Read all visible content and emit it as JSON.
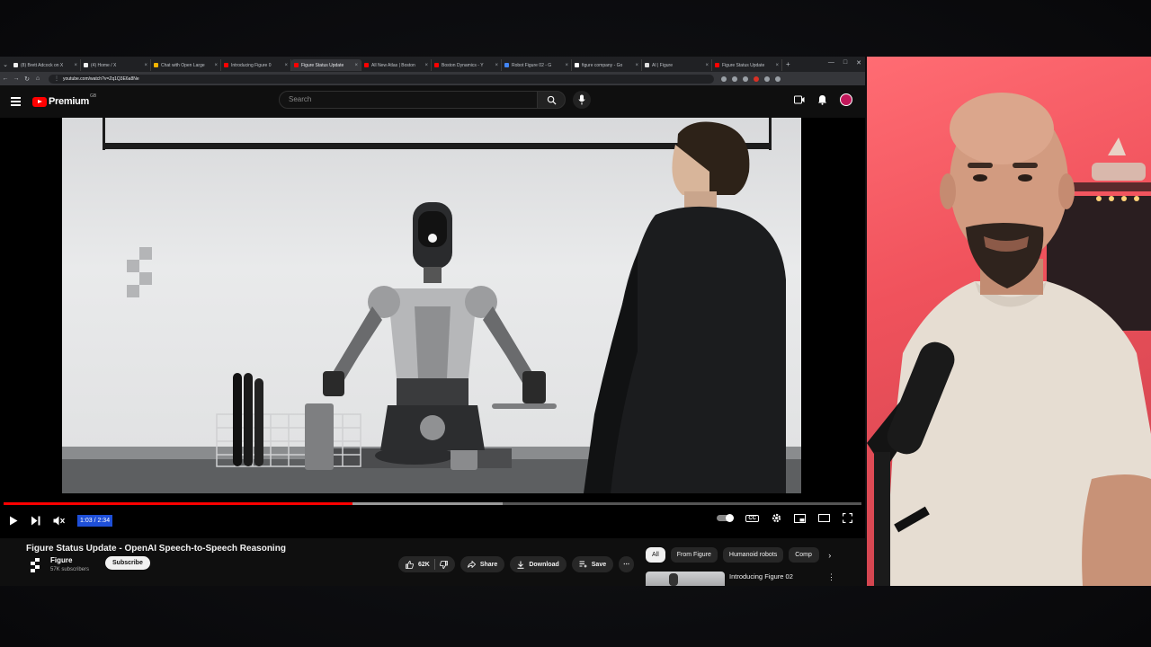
{
  "browser": {
    "tabs": [
      {
        "title": "(8) Brett Adcock on X",
        "favicon": "#eeeeee",
        "active": false
      },
      {
        "title": "(4) Home / X",
        "favicon": "#eeeeee",
        "active": false
      },
      {
        "title": "Chat with Open Large",
        "favicon": "#f4b400",
        "active": false
      },
      {
        "title": "Introducing Figure 0",
        "favicon": "#ff0000",
        "active": false
      },
      {
        "title": "Figure Status Update",
        "favicon": "#ff0000",
        "active": true
      },
      {
        "title": "All New Atlas | Boston",
        "favicon": "#ff0000",
        "active": false
      },
      {
        "title": "Boston Dynamics - Y",
        "favicon": "#ff0000",
        "active": false
      },
      {
        "title": "Robot Figure 02 - G",
        "favicon": "#4285f4",
        "active": false
      },
      {
        "title": "figure company - Go",
        "favicon": "#ffffff",
        "active": false
      },
      {
        "title": "AI | Figure",
        "favicon": "#dddddd",
        "active": false
      },
      {
        "title": "Figure Status Update",
        "favicon": "#ff0000",
        "active": false
      }
    ],
    "new_tab": "+",
    "url": "youtube.com/watch?v=Zq1Q3E6a8Ne"
  },
  "youtube": {
    "logo_text": "Premium",
    "region": "GB",
    "search_placeholder": "Search"
  },
  "player": {
    "time": "1:03 / 2:34",
    "progress_played": 0.407,
    "progress_loaded": 0.582
  },
  "video": {
    "title": "Figure Status Update - OpenAI Speech-to-Speech Reasoning",
    "channel": "Figure",
    "subscribers": "57K subscribers",
    "subscribe_label": "Subscribe",
    "likes": "62K",
    "share_label": "Share",
    "download_label": "Download",
    "save_label": "Save"
  },
  "chips": [
    "All",
    "From Figure",
    "Humanoid robots",
    "Comp"
  ],
  "recommended": {
    "title": "Introducing Figure 02"
  },
  "colors": {
    "accent": "#ff0000",
    "time_highlight": "#1e4fd8",
    "webcam_bg": "#f0525c"
  }
}
